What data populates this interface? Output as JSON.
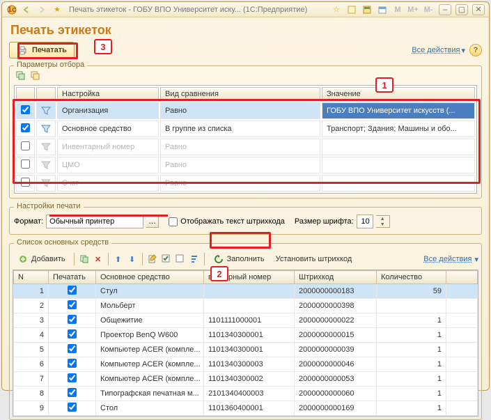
{
  "titlebar": {
    "title": "Печать этикеток - ГОБУ ВПО Университет иску...   (1С:Предприятие)"
  },
  "header": "Печать этикеток",
  "print_button": "Печатать",
  "all_actions": "Все действия",
  "groups": {
    "filter": "Параметры отбора",
    "print_settings": "Настройки печати",
    "assets_list": "Список основных средств"
  },
  "filter_table": {
    "cols": {
      "setting": "Настройка",
      "cmp": "Вид сравнения",
      "val": "Значение"
    },
    "rows": [
      {
        "on": true,
        "sel": true,
        "name": "Организация",
        "cmp": "Равно",
        "val": "ГОБУ ВПО Университет искусств (..."
      },
      {
        "on": true,
        "name": "Основное средство",
        "cmp": "В группе из списка",
        "val": "Транспорт; Здания; Машины и обо..."
      },
      {
        "on": false,
        "dis": true,
        "name": "Инвентарный номер",
        "cmp": "Равно",
        "val": ""
      },
      {
        "on": false,
        "dis": true,
        "name": "ЦМО",
        "cmp": "Равно",
        "val": ""
      },
      {
        "on": false,
        "dis": true,
        "name": "Счет",
        "cmp": "Равно",
        "val": ""
      }
    ]
  },
  "print": {
    "format_label": "Формат:",
    "format_value": "Обычный принтер",
    "show_barcode": "Отображать текст штрихкода",
    "font_label": "Размер шрифта:",
    "font_value": "10"
  },
  "toolbar": {
    "add": "Добавить",
    "fill": "Заполнить",
    "set_barcode": "Установить штрихкод",
    "all_actions": "Все действия"
  },
  "grid": {
    "cols": {
      "n": "N",
      "print": "Печатать",
      "asset": "Основное средство",
      "inv": "вентарный номер",
      "barcode": "Штрихкод",
      "qty": "Количество"
    },
    "rows": [
      {
        "n": "1",
        "chk": true,
        "asset": "Стул",
        "inv": "",
        "barcode": "2000000000183",
        "qty": "59",
        "sel": true
      },
      {
        "n": "2",
        "chk": true,
        "asset": "Мольберт",
        "inv": "",
        "barcode": "2000000000398",
        "qty": ""
      },
      {
        "n": "3",
        "chk": true,
        "asset": "Общежитие",
        "inv": "1101111000001",
        "barcode": "2000000000022",
        "qty": "1"
      },
      {
        "n": "4",
        "chk": true,
        "asset": "Проектор BenQ W600",
        "inv": "1101340300001",
        "barcode": "2000000000015",
        "qty": "1"
      },
      {
        "n": "5",
        "chk": true,
        "asset": "Компьютер ACER (компле...",
        "inv": "1101340300001",
        "barcode": "2000000000039",
        "qty": "1"
      },
      {
        "n": "6",
        "chk": true,
        "asset": "Компьютер ACER (компле...",
        "inv": "1101340300003",
        "barcode": "2000000000046",
        "qty": "1"
      },
      {
        "n": "7",
        "chk": true,
        "asset": "Компьютер ACER (компле...",
        "inv": "1101340300002",
        "barcode": "2000000000053",
        "qty": "1"
      },
      {
        "n": "8",
        "chk": true,
        "asset": "Типографская печатная м...",
        "inv": "2101340400003",
        "barcode": "2000000000060",
        "qty": "1"
      },
      {
        "n": "9",
        "chk": true,
        "asset": "Стол",
        "inv": "1101360400001",
        "barcode": "2000000000169",
        "qty": "1"
      }
    ]
  },
  "markers": {
    "m1": "1",
    "m2": "2",
    "m3": "3"
  }
}
